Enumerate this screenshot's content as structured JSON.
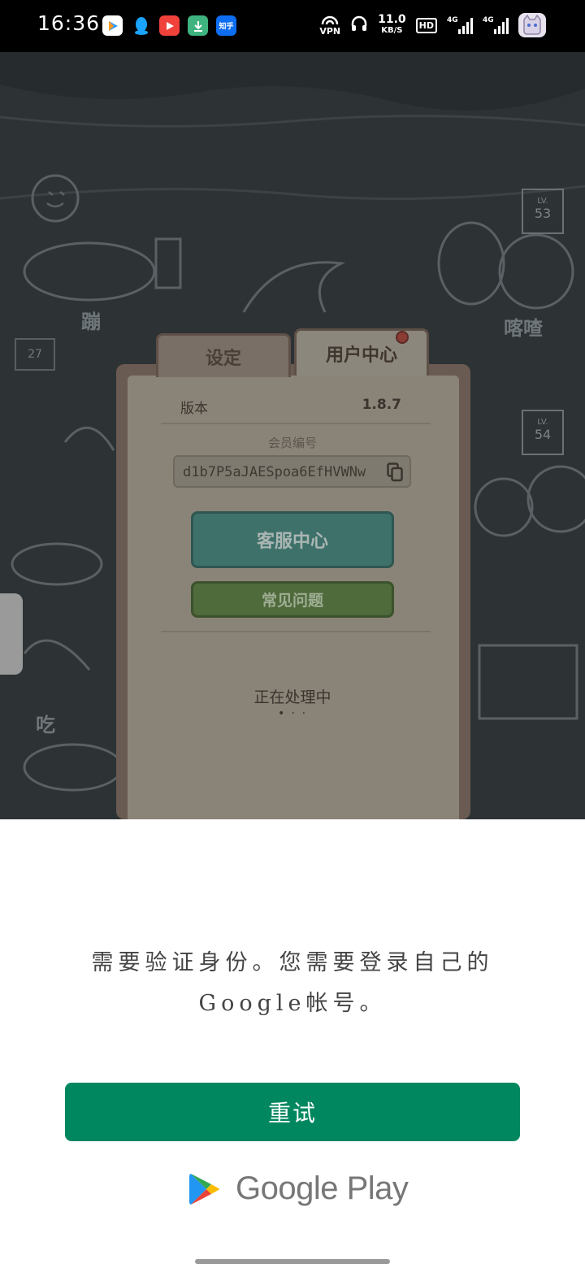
{
  "status_bar": {
    "time": "16:36",
    "apps": [
      {
        "name": "tencent-video",
        "label": "",
        "color": "#ffffff"
      },
      {
        "name": "qq",
        "label": "",
        "color": "#1aa3ff"
      },
      {
        "name": "video-app",
        "label": "",
        "color": "#f0413b"
      },
      {
        "name": "download",
        "label": "↓",
        "color": "#3fb37f"
      },
      {
        "name": "zhihu",
        "label": "知乎",
        "color": "#0d6ef2"
      }
    ],
    "vpn": "VPN",
    "net_speed": "11.0",
    "net_unit": "KB/S",
    "hd": "HD",
    "sim1": "4G",
    "sim2": "4G"
  },
  "game": {
    "lv_flags": [
      {
        "label": "LV.",
        "num": "53"
      },
      {
        "label": "LV.",
        "num": "54"
      }
    ],
    "onomatopoeia": [
      "蹦",
      "喀喳",
      "吃"
    ],
    "tile_number": "27"
  },
  "dialog": {
    "tabs": {
      "settings": "设定",
      "user_center": "用户中心"
    },
    "version_label": "版本",
    "version_value": "1.8.7",
    "member_label": "会员编号",
    "member_id": "d1b7P5aJAESpoa6EfHVWNw",
    "customer_service": "客服中心",
    "faq": "常见问题",
    "processing": "正在处理中",
    "dots": "• · ·"
  },
  "sheet": {
    "message": "需要验证身份。您需要登录自己的Google帐号。",
    "retry": "重试",
    "brand": "Google Play",
    "colors": {
      "retry": "#01875f"
    }
  }
}
